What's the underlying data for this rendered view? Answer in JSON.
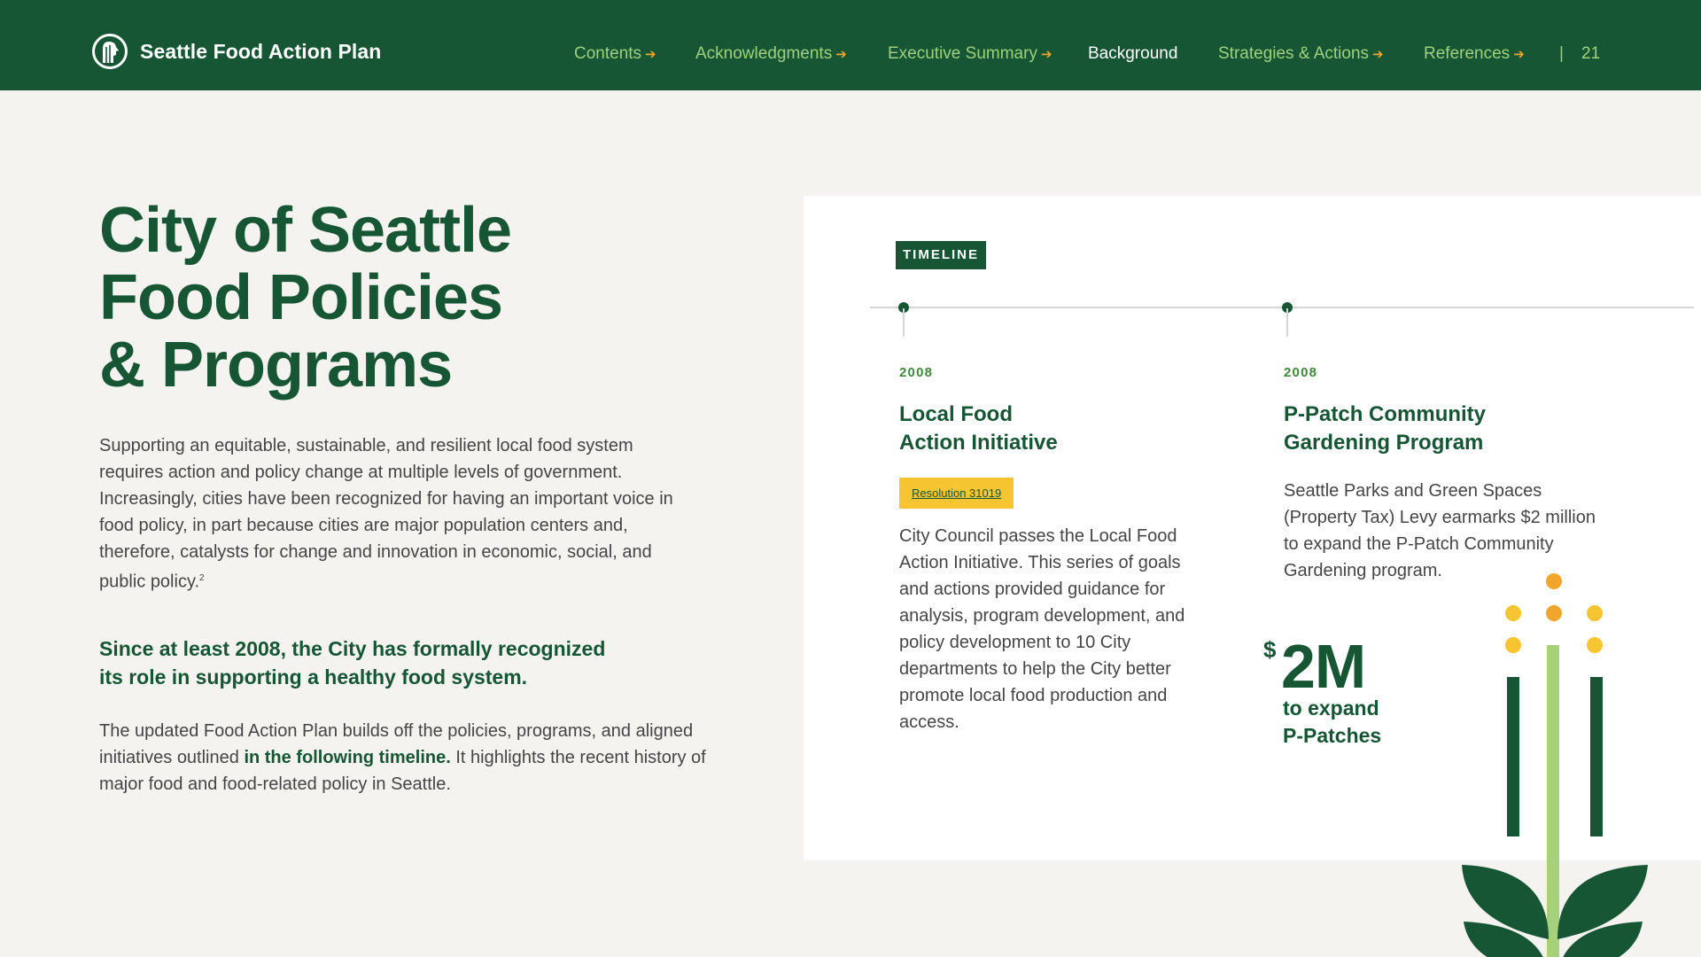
{
  "header": {
    "brand": "Seattle Food Action Plan",
    "logo_icon": "seattle-city-seal-icon",
    "nav": [
      {
        "label": "Contents",
        "arrow": "➔"
      },
      {
        "label": "Acknowledgments",
        "arrow": "➔"
      },
      {
        "label": "Executive Summary",
        "arrow": "➔"
      },
      {
        "label": "Background",
        "arrow": ""
      },
      {
        "label": "Strategies & Actions",
        "arrow": "➔"
      },
      {
        "label": "References",
        "arrow": "➔"
      }
    ],
    "active_nav": "Background",
    "separator": "|",
    "page_number": "21"
  },
  "main": {
    "title_lines": [
      "City of Seattle",
      "Food Policies",
      "& Programs"
    ],
    "intro": "Supporting an equitable, sustainable, and resilient local food system requires action and policy change at multiple levels of government. Increasingly, cities have been recognized for having an important voice in food policy, in part because cities are major population centers and, therefore, catalysts for change and innovation in economic, social, and public policy.",
    "intro_footnote": "2",
    "highlight_lines": [
      "Since at least 2008, the City has formally recognized",
      "its role in supporting a healthy food system."
    ],
    "outro_before": "The updated Food Action Plan builds off the policies, programs, and aligned initiatives outlined ",
    "outro_link": "in the following timeline.",
    "outro_after": " It highlights the recent history of major food and food-related policy in Seattle."
  },
  "timeline": {
    "tag": "TIMELINE",
    "events": [
      {
        "year": "2008",
        "title_lines": [
          "Local Food",
          "Action Initiative"
        ],
        "badge": "Resolution 31019",
        "description": "City Council passes the Local Food Action Initiative. This series of goals and actions provided guidance for analysis, program development, and policy development to 10 City departments to help the City better promote local food production and access."
      },
      {
        "year": "2008",
        "title_lines": [
          "P-Patch Community",
          "Gardening Program"
        ],
        "description": "Seattle Parks and Green Spaces (Property Tax) Levy earmarks $2 million to expand the P-Patch Community Gardening program."
      }
    ],
    "stat": {
      "symbol": "$",
      "value": "2M",
      "caption_lines": [
        "to expand",
        "P-Patches"
      ]
    }
  },
  "colors": {
    "brand_green": "#165634",
    "nav_green": "#9fd17c",
    "accent_orange": "#f2a52c",
    "badge_yellow": "#f7c531",
    "stem_light_green": "#a6d07c",
    "background": "#f4f3ef"
  },
  "decor": {
    "illustration": "plant-with-flowers-icon"
  }
}
